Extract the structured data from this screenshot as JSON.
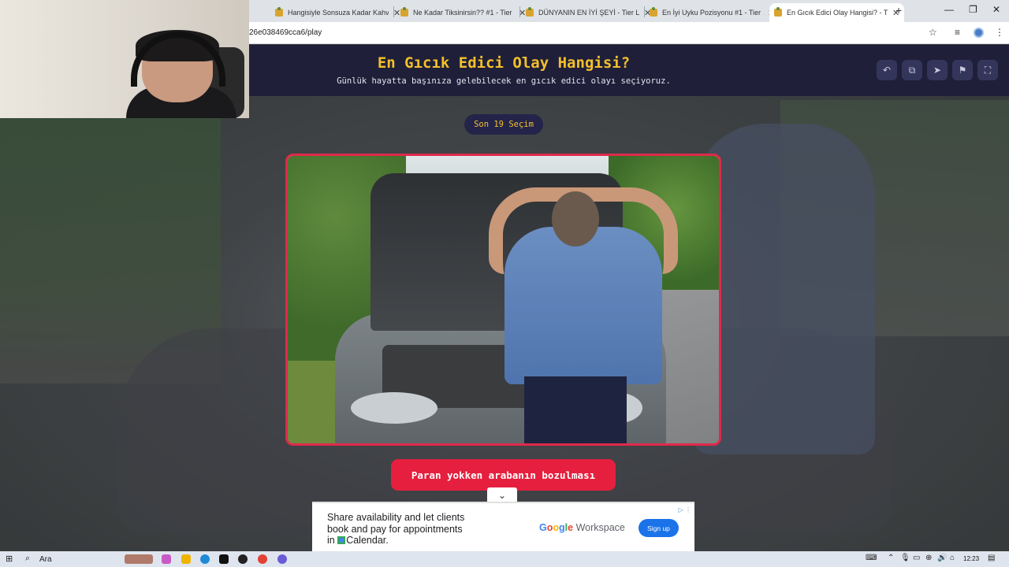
{
  "browser": {
    "tabs": [
      {
        "title": "Hangisiyle Sonsuza Kadar Kahv",
        "active": false
      },
      {
        "title": "Ne Kadar Tiksinirsin?? #1 - Tier",
        "active": false
      },
      {
        "title": "DÜNYANIN EN İYİ ŞEYİ - Tier Li",
        "active": false
      },
      {
        "title": "En İyi Uyku Pozisyonu #1 - Tier",
        "active": false
      },
      {
        "title": "En Gıcık Edici Olay Hangisi? - T",
        "active": true
      }
    ],
    "new_tab": "+",
    "url": "26e038469cca6/play"
  },
  "header": {
    "title": "En Gıcık Edici Olay Hangisi?",
    "subtitle": "Günlük hayatta başınıza gelebilecek en gıcık edici olayı seçiyoruz.",
    "buttons": [
      "undo-icon",
      "share-icon",
      "send-icon",
      "flag-icon",
      "fullscreen-icon"
    ]
  },
  "round_label": "Son 19 Seçim",
  "choice": {
    "label": "Paran yokken arabanın bozulması",
    "image": "man-with-broken-car"
  },
  "ad": {
    "line1": "Share availability and let clients",
    "line2": "book and pay for appointments",
    "line3_prefix": "in ",
    "line3_suffix": "Calendar.",
    "brand": "Workspace",
    "cta": "Sign up"
  },
  "taskbar": {
    "search": "Ara",
    "time": "12:23"
  },
  "colors": {
    "accent": "#e51f3d",
    "title": "#f4c02a",
    "header_bg": "#1f1f3a"
  }
}
